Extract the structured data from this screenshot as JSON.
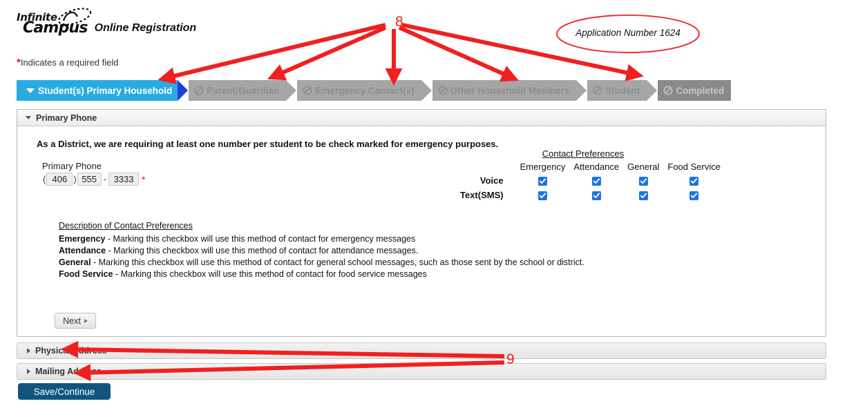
{
  "brand": {
    "line1": "Infinite",
    "line2": "Campus",
    "product": "Online Registration",
    "swoosh_icon": "campus-swoosh-icon"
  },
  "required_note": {
    "star": "*",
    "text": "Indicates a required field"
  },
  "tabs": [
    {
      "label": "Student(s) Primary Household",
      "state": "active",
      "icon": "caret-down-icon"
    },
    {
      "label": "Parent/Guardian",
      "state": "locked",
      "icon": "no-entry-icon"
    },
    {
      "label": "Emergency Contact(s)",
      "state": "locked",
      "icon": "no-entry-icon"
    },
    {
      "label": "Other Household Members",
      "state": "locked",
      "icon": "no-entry-icon"
    },
    {
      "label": "Student",
      "state": "locked",
      "icon": "no-entry-icon"
    },
    {
      "label": "Completed",
      "state": "done",
      "icon": "no-entry-icon"
    }
  ],
  "panel": {
    "header_title": "Primary Phone",
    "intro": "As a District, we are requiring at least one number per student to be check marked for emergency purposes.",
    "phone": {
      "label": "Primary Phone",
      "open_paren": "(",
      "close_paren": ")",
      "dash": "-",
      "area_code": "406",
      "prefix": "555",
      "line": "3333",
      "required_marker": "*"
    },
    "preferences": {
      "title": "Contact Preferences",
      "columns": [
        "Emergency",
        "Attendance",
        "General",
        "Food Service"
      ],
      "rows": [
        {
          "label": "Voice",
          "values": [
            true,
            true,
            true,
            true
          ]
        },
        {
          "label": "Text(SMS)",
          "values": [
            true,
            true,
            true,
            true
          ]
        }
      ]
    },
    "description": {
      "title": "Description of Contact Preferences",
      "items": [
        {
          "term": "Emergency",
          "text": " - Marking this checkbox will use this method of contact for emergency messages"
        },
        {
          "term": "Attendance",
          "text": " - Marking this checkbox will use this method of contact for attendance messages."
        },
        {
          "term": "General",
          "text": " - Marking this checkbox will use this method of contact for general school messages, such as those sent by the school or district."
        },
        {
          "term": "Food Service",
          "text": " - Marking this checkbox will use this method of contact for food service messages"
        }
      ]
    },
    "next_label": "Next"
  },
  "collapsed_sections": [
    {
      "label": "Physical Address",
      "icon": "caret-right-icon"
    },
    {
      "label": "Mailing Address",
      "icon": "caret-right-icon"
    }
  ],
  "save_button": {
    "label": "Save/Continue"
  },
  "annotations": {
    "callout_8": "8",
    "callout_9": "9",
    "application_note": "Application Number 1624",
    "color": "#f02020"
  }
}
